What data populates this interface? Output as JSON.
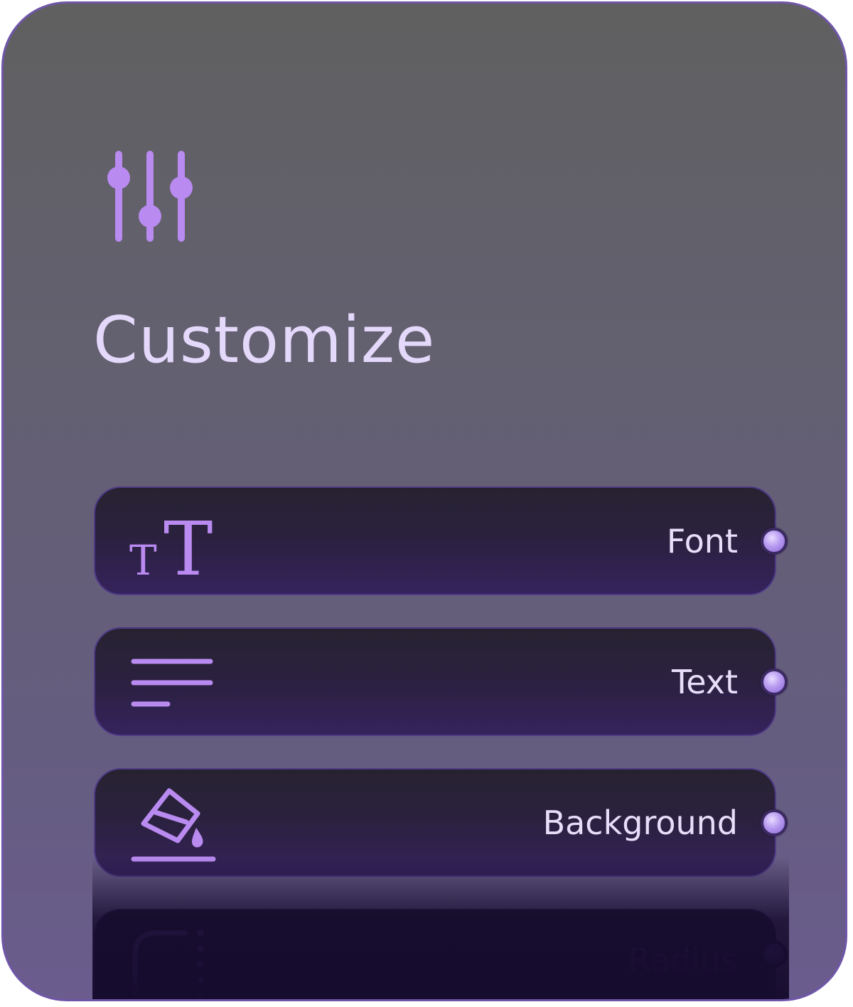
{
  "panel": {
    "title": "Customize",
    "icon": "sliders-icon",
    "accent_color": "#b98af0",
    "title_color": "#e4d8fb"
  },
  "items": [
    {
      "label": "Font",
      "icon": "font-size-icon"
    },
    {
      "label": "Text",
      "icon": "text-align-icon"
    },
    {
      "label": "Background",
      "icon": "paint-bucket-icon"
    },
    {
      "label": "Radius",
      "icon": "corner-radius-icon",
      "state": "faded"
    }
  ]
}
